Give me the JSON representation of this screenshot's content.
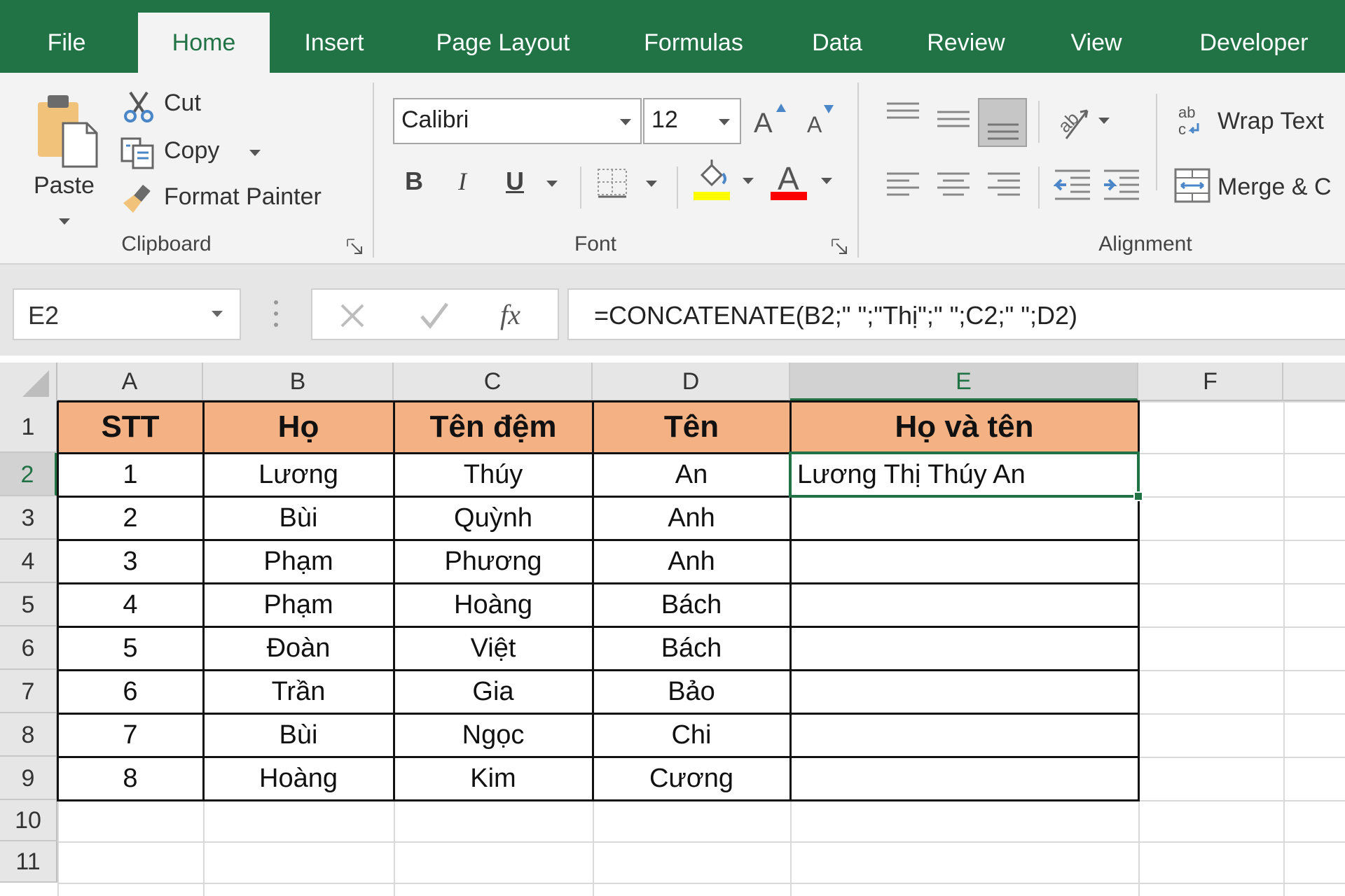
{
  "tabs": [
    {
      "label": "File",
      "active": false
    },
    {
      "label": "Home",
      "active": true
    },
    {
      "label": "Insert",
      "active": false
    },
    {
      "label": "Page Layout",
      "active": false
    },
    {
      "label": "Formulas",
      "active": false
    },
    {
      "label": "Data",
      "active": false
    },
    {
      "label": "Review",
      "active": false
    },
    {
      "label": "View",
      "active": false
    },
    {
      "label": "Developer",
      "active": false
    }
  ],
  "ribbon": {
    "clipboard": {
      "group_label": "Clipboard",
      "paste_label": "Paste",
      "cut_label": "Cut",
      "copy_label": "Copy",
      "format_painter_label": "Format Painter"
    },
    "font": {
      "group_label": "Font",
      "font_name": "Calibri",
      "font_size": "12",
      "bold_label": "B",
      "italic_label": "I",
      "underline_label": "U",
      "grow_label": "A",
      "shrink_label": "A",
      "font_color_label": "A",
      "highlight_color": "#ffff00",
      "font_color": "#ff0000"
    },
    "alignment": {
      "group_label": "Alignment",
      "wrap_text_label": "Wrap Text",
      "merge_label": "Merge & C",
      "wrap_icon_label": "ab"
    }
  },
  "formula_bar": {
    "name_box": "E2",
    "formula": "=CONCATENATE(B2;\" \";\"Thị\";\" \";C2;\" \";D2)",
    "fx_label": "fx"
  },
  "sheet": {
    "columns": [
      "A",
      "B",
      "C",
      "D",
      "E",
      "F"
    ],
    "selected_column": "E",
    "selected_row": "2",
    "row_numbers": [
      "1",
      "2",
      "3",
      "4",
      "5",
      "6",
      "7",
      "8",
      "9",
      "10",
      "11"
    ],
    "header_fill": "#f4b183",
    "accent": "#217346",
    "headers": [
      "STT",
      "Họ",
      "Tên đệm",
      "Tên",
      "Họ và tên"
    ],
    "rows": [
      [
        "1",
        "Lương",
        "Thúy",
        "An",
        "Lương Thị Thúy An"
      ],
      [
        "2",
        "Bùi",
        "Quỳnh",
        "Anh",
        ""
      ],
      [
        "3",
        "Phạm",
        "Phương",
        "Anh",
        ""
      ],
      [
        "4",
        "Phạm",
        "Hoàng",
        "Bách",
        ""
      ],
      [
        "5",
        "Đoàn",
        "Việt",
        "Bách",
        ""
      ],
      [
        "6",
        "Trần",
        "Gia",
        "Bảo",
        ""
      ],
      [
        "7",
        "Bùi",
        "Ngọc",
        "Chi",
        ""
      ],
      [
        "8",
        "Hoàng",
        "Kim",
        "Cương",
        ""
      ]
    ]
  }
}
